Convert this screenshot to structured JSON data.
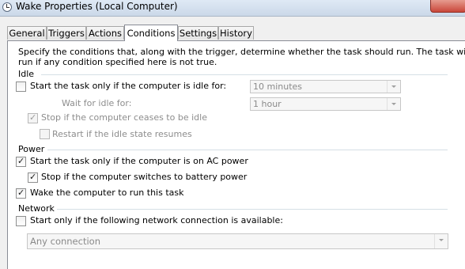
{
  "window": {
    "title": "Wake Properties (Local Computer)"
  },
  "tabs": [
    {
      "label": "General"
    },
    {
      "label": "Triggers"
    },
    {
      "label": "Actions"
    },
    {
      "label": "Conditions",
      "active": true
    },
    {
      "label": "Settings"
    },
    {
      "label": "History"
    }
  ],
  "conditions": {
    "description_line1": "Specify the conditions that, along with the trigger, determine whether the task should run.  The task will not",
    "description_line2": "run  if any condition specified here is not true.",
    "idle": {
      "group_label": "Idle",
      "start_if_idle": {
        "label": "Start the task only if the computer is idle for:",
        "checked": false
      },
      "idle_duration": {
        "value": "10 minutes"
      },
      "wait_for_idle_label": "Wait for idle for:",
      "wait_duration": {
        "value": "1 hour"
      },
      "stop_if_not_idle": {
        "label": "Stop if the computer ceases to be idle",
        "checked": true,
        "enabled": false
      },
      "restart_if_idle": {
        "label": "Restart if the idle state resumes",
        "checked": false,
        "enabled": false
      }
    },
    "power": {
      "group_label": "Power",
      "start_on_ac": {
        "label": "Start the task only if the computer is on AC power",
        "checked": true
      },
      "stop_on_battery": {
        "label": "Stop if the computer switches to battery power",
        "checked": true
      },
      "wake_to_run": {
        "label": "Wake the computer to run this task",
        "checked": true
      }
    },
    "network": {
      "group_label": "Network",
      "start_if_network": {
        "label": "Start only if the following network connection is available:",
        "checked": false
      },
      "connection": {
        "value": "Any connection"
      }
    }
  }
}
